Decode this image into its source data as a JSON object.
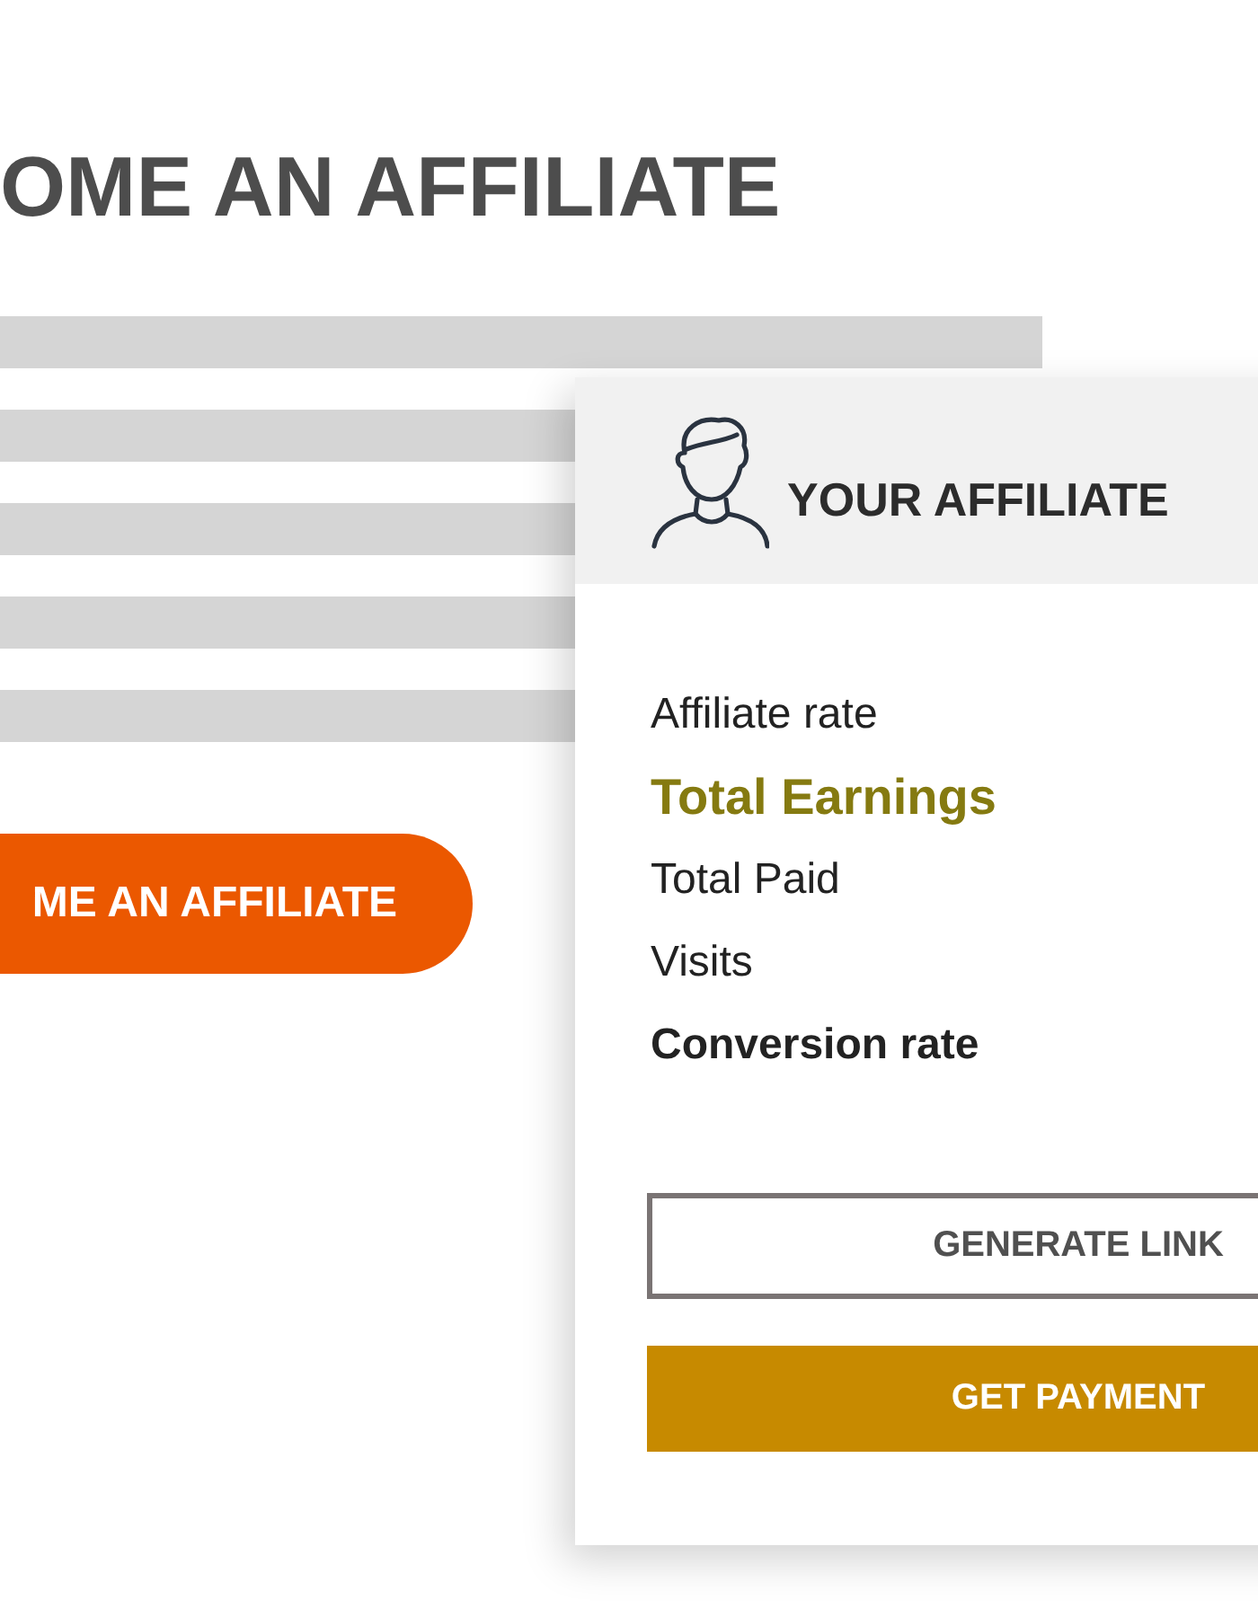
{
  "heading": "OME AN AFFILIATE",
  "cta_button": "ME AN AFFILIATE",
  "card": {
    "title": "YOUR AFFILIATE",
    "items": [
      {
        "label": "Affiliate rate",
        "kind": "normal"
      },
      {
        "label": "Total Earnings",
        "kind": "highlight"
      },
      {
        "label": "Total Paid",
        "kind": "normal"
      },
      {
        "label": "Visits",
        "kind": "normal"
      },
      {
        "label": "Conversion rate",
        "kind": "strong"
      }
    ],
    "buttons": [
      {
        "label": "GENERATE LINK",
        "kind": "outline"
      },
      {
        "label": "GET PAYMENT",
        "kind": "filled"
      }
    ]
  }
}
